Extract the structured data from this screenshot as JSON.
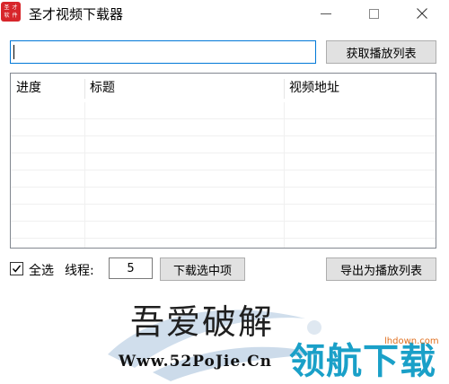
{
  "window": {
    "icon_text": [
      "圣",
      "才",
      "软",
      "件"
    ],
    "title": "圣才视频下载器"
  },
  "toolbar": {
    "url_value": "",
    "fetch_label": "获取播放列表"
  },
  "list": {
    "columns": [
      "进度",
      "标题",
      "视频地址"
    ],
    "rows": 8
  },
  "footer": {
    "select_all_label": "全选",
    "select_all_checked": true,
    "thread_label": "线程:",
    "thread_value": "5",
    "download_label": "下载选中项",
    "export_label": "导出为播放列表"
  },
  "watermark": {
    "big_text": "吾爱破解",
    "url_text": "Www.52PoJie.Cn",
    "brand_text": "领航下载",
    "site_text": "lhdown.com"
  },
  "colors": {
    "accent": "#0078d7",
    "icon_red": "#d7262b",
    "brand_blue": "#1aa0c8"
  }
}
